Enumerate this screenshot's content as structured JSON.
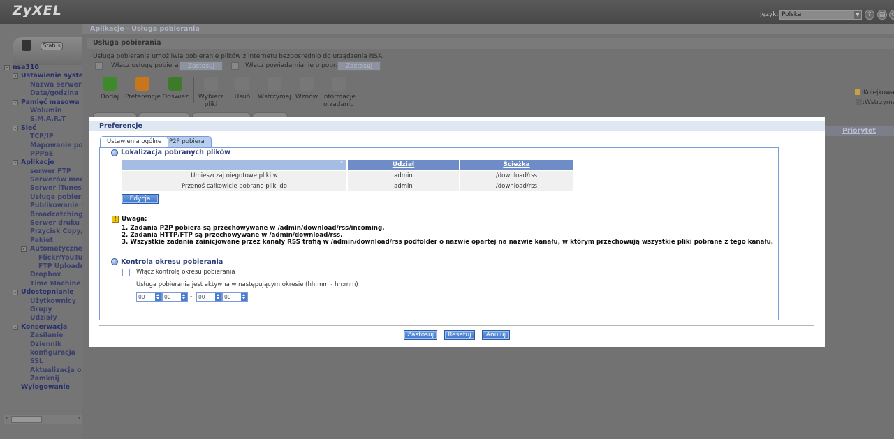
{
  "header": {
    "logo": "ZyXEL",
    "language_label": "Język:",
    "language_value": "Polska"
  },
  "status_button": "Status",
  "tree": [
    {
      "label": "nsa310",
      "level": 0,
      "box": "-"
    },
    {
      "label": "Ustawienie systemu",
      "level": 1,
      "box": "-"
    },
    {
      "label": "Nazwa serwera",
      "level": 2
    },
    {
      "label": "Data/godzina",
      "level": 2
    },
    {
      "label": "Pamięć masowa",
      "level": 1,
      "box": "-"
    },
    {
      "label": "Wolumin",
      "level": 2
    },
    {
      "label": "S.M.A.R.T",
      "level": 2
    },
    {
      "label": "Sieć",
      "level": 1,
      "box": "-"
    },
    {
      "label": "TCP/IP",
      "level": 2
    },
    {
      "label": "Mapowanie portów",
      "level": 2
    },
    {
      "label": "PPPoE",
      "level": 2
    },
    {
      "label": "Aplikacje",
      "level": 1,
      "box": "-"
    },
    {
      "label": "serwer FTP",
      "level": 2
    },
    {
      "label": "Serwerów mediów",
      "level": 2
    },
    {
      "label": "Serwer iTunes",
      "level": 2
    },
    {
      "label": "Usługa pobierania",
      "level": 2
    },
    {
      "label": "Publikowanie w sieci",
      "level": 2
    },
    {
      "label": "Broadcatching",
      "level": 2
    },
    {
      "label": "Serwer druku",
      "level": 2
    },
    {
      "label": "Przycisk Copy/Sync",
      "level": 2
    },
    {
      "label": "Pakiet",
      "level": 2
    },
    {
      "label": "Automatyczne wysyłanie",
      "level": 2,
      "box": "-"
    },
    {
      "label": "Flickr/YouTube",
      "level": 3
    },
    {
      "label": "FTP Uploadr",
      "level": 3
    },
    {
      "label": "Dropbox",
      "level": 2
    },
    {
      "label": "Time Machine",
      "level": 2
    },
    {
      "label": "Udostępnianie",
      "level": 1,
      "box": "-"
    },
    {
      "label": "Użytkownicy",
      "level": 2
    },
    {
      "label": "Grupy",
      "level": 2
    },
    {
      "label": "Udziały",
      "level": 2
    },
    {
      "label": "Konserwacja",
      "level": 1,
      "box": "-"
    },
    {
      "label": "Zasilanie",
      "level": 2
    },
    {
      "label": "Dziennik",
      "level": 2
    },
    {
      "label": "konfiguracja",
      "level": 2
    },
    {
      "label": "SSL",
      "level": 2
    },
    {
      "label": "Aktualizacja oprogramowania",
      "level": 2
    },
    {
      "label": "Zamknij",
      "level": 2
    },
    {
      "label": "Wylogowanie",
      "level": 1
    }
  ],
  "page": {
    "breadcrumb": "Aplikacje - Usługa pobierania",
    "panel_title": "Usługa pobierania",
    "description": "Usługa pobierania umożliwia pobieranie plików z internetu bezpośrednio do urządzenia NSA.",
    "enable_service_label": "Włącz usługę pobierania",
    "enable_notify_label": "Włącz powiadamianie o pobraniu",
    "apply_label": "Zastosuj",
    "toolbar": [
      {
        "label": "Dodaj",
        "icon": "add-icon",
        "color": "#3d8a2a"
      },
      {
        "label": "Preferencje",
        "icon": "preferences-icon",
        "color": "#c8761e"
      },
      {
        "label": "Odśwież",
        "icon": "refresh-icon",
        "color": "#3d7a2a"
      },
      {
        "label": "Wybierz pliki",
        "icon": "select-files-icon",
        "color": "#777777"
      },
      {
        "label": "Usuń",
        "icon": "delete-icon",
        "color": "#777777"
      },
      {
        "label": "Wstrzymaj",
        "icon": "pause-icon",
        "color": "#777777"
      },
      {
        "label": "Wznów",
        "icon": "resume-icon",
        "color": "#777777"
      },
      {
        "label": "Informacje o zadaniu",
        "icon": "info-icon",
        "color": "#777777"
      }
    ],
    "legend": [
      ":Kolejkowane",
      ":Wstrzymane"
    ],
    "priority_header": "Priorytet"
  },
  "modal": {
    "title": "Preferencje",
    "tabs": [
      "Ustawienia ogólne",
      "P2P pobiera"
    ],
    "location_title": "Lokalizacja pobranych plików",
    "table": {
      "headers": [
        "",
        "Udział",
        "Ścieżka"
      ],
      "rows": [
        [
          "Umieszczaj niegotowe pliki w",
          "admin",
          "/download/rss"
        ],
        [
          "Przenoś całkowicie pobrane pliki do",
          "admin",
          "/download/rss"
        ]
      ]
    },
    "edit_label": "Edycja",
    "note_title": "Uwaga:",
    "notes": [
      "1. Zadania P2P pobiera są przechowywane w /admin/download/rss/incoming.",
      "2. Zadania HTTP/FTP są przechowywane w /admin/download/rss.",
      "3. Wszystkie zadania zainicjowane przez kanały RSS trafią w /admin/download/rss podfolder o nazwie opartej na nazwie kanału, w którym przechowują wszystkie pliki pobrane z tego kanału."
    ],
    "period_title": "Kontrola okresu pobierania",
    "period_checkbox_label": "Włącz kontrolę okresu pobierania",
    "period_desc": "Usługa pobierania jest aktywna w następującym okresie (hh:mm - hh:mm)",
    "time": [
      "00",
      "00",
      "00",
      "00"
    ],
    "time_sep_colon": ":",
    "time_sep_dash": "-",
    "buttons": {
      "apply": "Zastosuj",
      "reset": "Resetuj",
      "cancel": "Anuluj"
    }
  }
}
